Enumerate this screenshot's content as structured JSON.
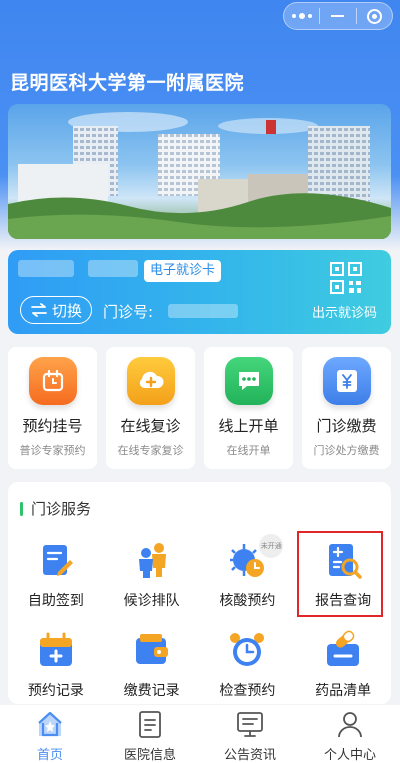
{
  "window": {
    "title": "昆明医科大学第一附属医院"
  },
  "capsule": {
    "menu_icon": "more-dots-icon",
    "minimize_icon": "minimize-icon",
    "close_icon": "target-close-icon"
  },
  "card": {
    "tag": "电子就诊卡",
    "switch_label": "切换",
    "clinic_label": "门诊号:",
    "qr_label": "出示就诊码"
  },
  "quick_actions": [
    {
      "label": "预约挂号",
      "sub": "普诊专家预约",
      "icon": "alarm-clock-icon",
      "color": "#f87a2a"
    },
    {
      "label": "在线复诊",
      "sub": "在线专家复诊",
      "icon": "cloud-plus-icon",
      "color": "#f7b021"
    },
    {
      "label": "线上开单",
      "sub": "在线开单",
      "icon": "chat-bubble-icon",
      "color": "#2fc46a"
    },
    {
      "label": "门诊缴费",
      "sub": "门诊处方缴费",
      "icon": "yen-bill-icon",
      "color": "#4a8ef3"
    }
  ],
  "services": {
    "title": "门诊服务",
    "items": [
      {
        "label": "自助签到",
        "icon": "edit-document-icon"
      },
      {
        "label": "候诊排队",
        "icon": "queue-people-icon"
      },
      {
        "label": "核酸预约",
        "icon": "virus-clock-icon",
        "stamp": "未开通"
      },
      {
        "label": "报告查询",
        "icon": "report-search-icon"
      },
      {
        "label": "预约记录",
        "icon": "calendar-plus-icon"
      },
      {
        "label": "缴费记录",
        "icon": "wallet-icon"
      },
      {
        "label": "检查预约",
        "icon": "alarm-clock-icon"
      },
      {
        "label": "药品清单",
        "icon": "medicine-icon"
      }
    ]
  },
  "tabbar": [
    {
      "label": "首页",
      "icon": "home-icon",
      "active": true
    },
    {
      "label": "医院信息",
      "icon": "hospital-info-icon"
    },
    {
      "label": "公告资讯",
      "icon": "notice-board-icon"
    },
    {
      "label": "个人中心",
      "icon": "user-icon"
    }
  ],
  "colors": {
    "primary": "#4a8ef3",
    "highlight": "#e02626",
    "service_bar": "#2ec36a"
  }
}
